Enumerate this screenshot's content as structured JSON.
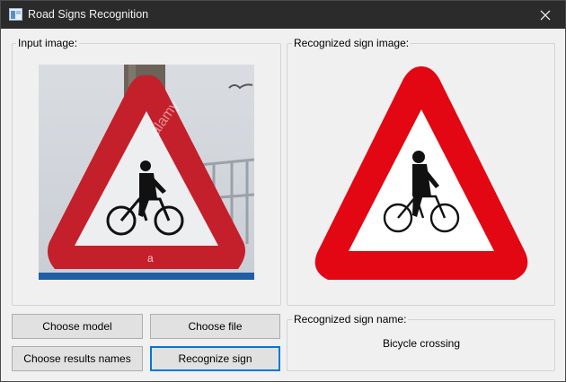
{
  "window": {
    "title": "Road Signs Recognition",
    "app_icon": "window-app-icon",
    "close_icon": "close-icon"
  },
  "input_panel": {
    "label": "Input image:",
    "image": "photo-of-triangular-bicycle-crossing-road-sign",
    "watermark_text": "alamy"
  },
  "recognized_panel": {
    "label": "Recognized sign image:",
    "image": "bicycle-crossing-warning-sign"
  },
  "buttons": {
    "choose_model": "Choose model",
    "choose_file": "Choose file",
    "choose_results_names": "Choose results names",
    "recognize_sign": "Recognize sign"
  },
  "result_panel": {
    "label": "Recognized sign name:",
    "value": "Bicycle crossing"
  },
  "colors": {
    "sign_red": "#e30613",
    "titlebar": "#2b2b2b",
    "focus_blue": "#0078d7"
  }
}
